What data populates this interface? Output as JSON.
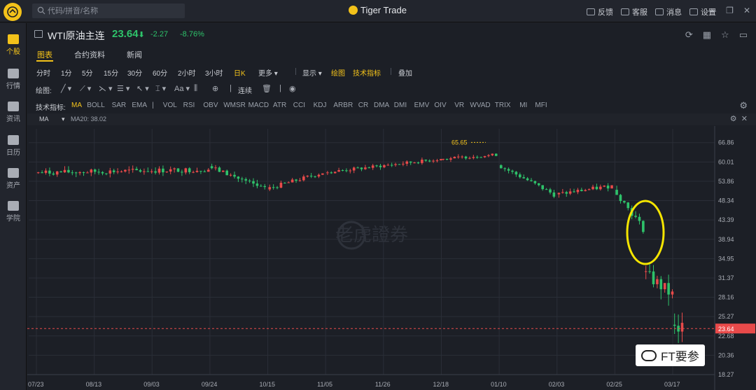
{
  "search": {
    "placeholder": "代码/拼音/名称"
  },
  "brand": {
    "name": "Tiger Trade"
  },
  "top_actions": [
    "反馈",
    "客服",
    "消息",
    "设置"
  ],
  "rail": [
    {
      "label": "个股",
      "active": true
    },
    {
      "label": "行情"
    },
    {
      "label": "资讯"
    },
    {
      "label": "日历"
    },
    {
      "label": "资产"
    },
    {
      "label": "学院"
    }
  ],
  "header": {
    "symbol": "WTI原油主连",
    "price": "23.64",
    "change": "-2.27",
    "change_pct": "-8.76%"
  },
  "tabs": [
    "图表",
    "合约资料",
    "新闻"
  ],
  "periods": [
    "分时",
    "1分",
    "5分",
    "15分",
    "30分",
    "60分",
    "2小时",
    "3小时",
    "日K",
    "更多 ▾",
    "显示 ▾",
    "绘图",
    "技术指标",
    "叠加"
  ],
  "draw": {
    "label": "绘图:",
    "continuous": "连续"
  },
  "indicators": {
    "label": "技术指标:",
    "items": [
      "MA",
      "BOLL",
      "SAR",
      "EMA",
      "|",
      "VOL",
      "RSI",
      "OBV",
      "WMSR",
      "MACD",
      "ATR",
      "CCI",
      "KDJ",
      "ARBR",
      "CR",
      "DMA",
      "DMI",
      "EMV",
      "OIV",
      "VR",
      "WVAD",
      "TRIX",
      "MI",
      "MFI"
    ]
  },
  "ma_strip": {
    "select": "MA",
    "ma20": "MA20: 38.02"
  },
  "watermark": {
    "text": "老虎證券"
  },
  "badge": {
    "text": "FT要参"
  },
  "colors": {
    "up": "#e84a4a",
    "down": "#2ec26a",
    "accent": "#f3c21a",
    "bg": "#1c1f26"
  },
  "chart_data": {
    "type": "candlestick",
    "y_ticks": [
      66.86,
      60.01,
      53.86,
      48.34,
      43.39,
      38.94,
      34.95,
      31.37,
      28.16,
      25.27,
      22.68,
      20.36,
      18.27
    ],
    "x_ticks": [
      "07/23",
      "08/13",
      "09/03",
      "09/24",
      "10/15",
      "11/05",
      "11/26",
      "12/18",
      "01/10",
      "02/03",
      "02/25",
      "03/17"
    ],
    "ylim": [
      18.27,
      70.0
    ],
    "scale": "log",
    "last_price": 23.64,
    "high_label": "65.65",
    "grid": true,
    "annotation": "yellow circle around early-March gap down",
    "segments": [
      {
        "from": "07/23",
        "to": "09/24",
        "start": 56.5,
        "end": 57.5,
        "noise": 1.6
      },
      {
        "from": "09/24",
        "to": "10/15",
        "start": 58.5,
        "end": 51.5,
        "noise": 1.4
      },
      {
        "from": "10/15",
        "to": "11/05",
        "start": 51.5,
        "end": 56.5,
        "noise": 1.2
      },
      {
        "from": "11/05",
        "to": "12/18",
        "start": 56.5,
        "end": 61.0,
        "noise": 1.1
      },
      {
        "from": "12/18",
        "to": "01/10",
        "start": 61.0,
        "end": 62.5,
        "noise": 1.0
      },
      {
        "from": "01/10",
        "to": "02/03",
        "start": 59.0,
        "end": 50.0,
        "noise": 1.2
      },
      {
        "from": "02/03",
        "to": "02/25",
        "start": 50.0,
        "end": 52.5,
        "noise": 1.2
      },
      {
        "from": "02/25",
        "to": "03/06",
        "start": 51.5,
        "end": 41.3,
        "noise": 1.5
      },
      {
        "from": "03/06",
        "to": "03/17",
        "start": 32.5,
        "end": 28.5,
        "noise": 2.2
      },
      {
        "from": "03/17",
        "to": "03/20",
        "start": 24.0,
        "end": 23.6,
        "noise": 2.4
      }
    ]
  }
}
